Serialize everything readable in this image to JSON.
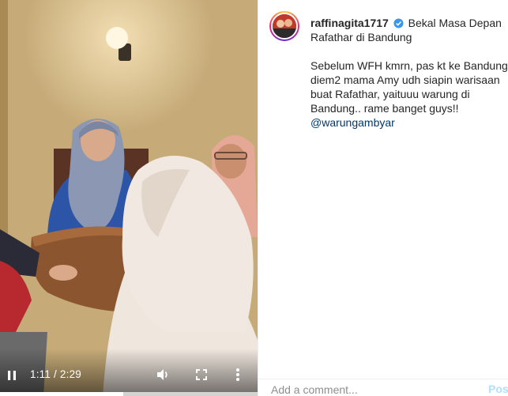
{
  "video": {
    "current_time": "1:11",
    "duration": "2:29",
    "time_display": "1:11 / 2:29",
    "progress_fraction": 0.477,
    "icons": {
      "play": "play-pause-icon",
      "volume": "volume-icon",
      "fullscreen": "fullscreen-icon",
      "more": "more-options-icon"
    }
  },
  "post": {
    "username": "raffinagita1717",
    "verified": true,
    "title_line": "Bekal Masa Depan Rafathar di Bandung",
    "body": "Sebelum WFH kmrn, pas kt ke Bandung, diem2 mama Amy udh siapin warisaan buat Rafathar, yaituuu warung di Bandung.. rame banget guys!!",
    "mention": "@warungambyar"
  },
  "comment": {
    "placeholder": "Add a comment...",
    "post_label": "Post"
  },
  "colors": {
    "link": "#00376b",
    "post_disabled": "#b2dffc",
    "verified_badge": "#3897f0"
  }
}
